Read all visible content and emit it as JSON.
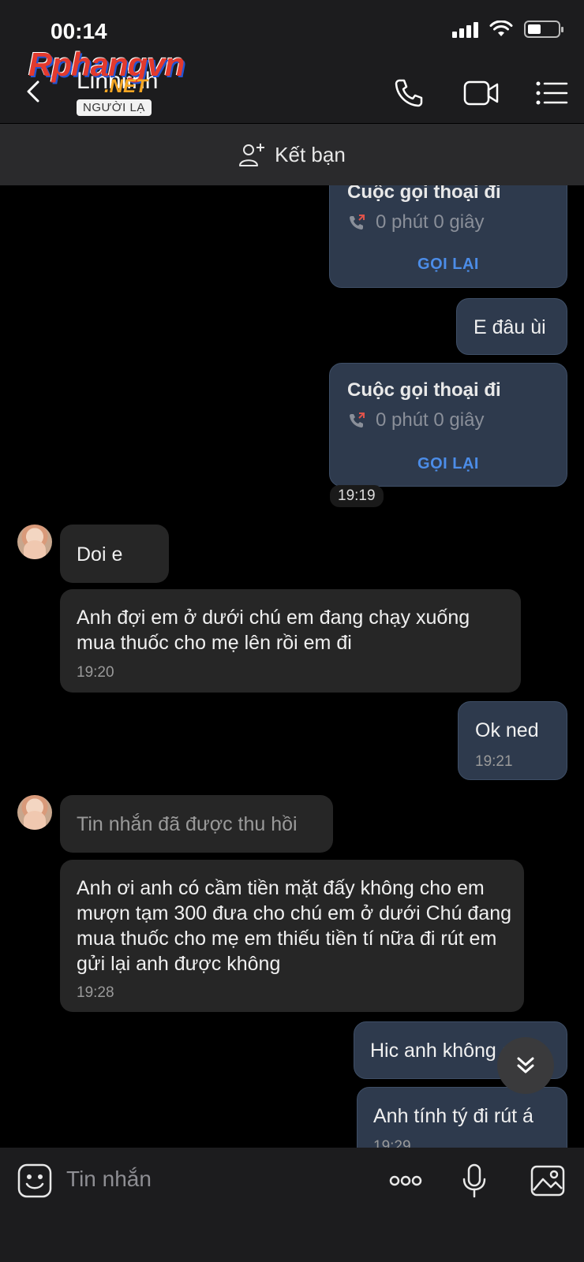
{
  "status_bar": {
    "time": "00:14",
    "battery_level": 0.45
  },
  "watermark": {
    "brand": "Rphangvn",
    "suffix": ".NET"
  },
  "header": {
    "contact_name": "Linhlinh",
    "badge": "NGƯỜI LẠ",
    "icons": [
      "back-icon",
      "phone-icon",
      "video-icon",
      "menu-icon"
    ]
  },
  "friend_bar": {
    "label": "Kết bạn",
    "icon": "add-friend-icon"
  },
  "messages": {
    "call1": {
      "title": "Cuộc gọi thoại đi",
      "duration": "0 phút 0 giây",
      "action": "GỌI LẠI"
    },
    "out1": {
      "text": "E đâu ùi"
    },
    "call2": {
      "title": "Cuộc gọi thoại đi",
      "duration": "0 phút 0 giây",
      "action": "GỌI LẠI"
    },
    "time_chip": "19:19",
    "in1": {
      "text": "Doi e"
    },
    "in2": {
      "text": "Anh đợi em ở dưới chú em đang chạy xuống mua thuốc cho mẹ lên rồi em đi",
      "time": "19:20"
    },
    "out2": {
      "text": "Ok ned",
      "time": "19:21"
    },
    "in3": {
      "text": "Tin nhắn đã được thu hồi"
    },
    "in4": {
      "text": "Anh ơi anh có cầm tiền mặt đấy không cho em mượn tạm 300 đưa cho chú em ở dưới Chú đang mua thuốc cho mẹ em thiếu tiền tí nữa đi rút em gửi lại anh được không",
      "time": "19:28"
    },
    "out3": {
      "text": "Hic anh không cod"
    },
    "out4": {
      "text": "Anh tính tý đi rút á",
      "time": "19:29"
    }
  },
  "input_bar": {
    "placeholder": "Tin nhắn",
    "icons": [
      "emoji-icon",
      "more-icon",
      "microphone-icon",
      "image-icon"
    ]
  },
  "colors": {
    "background": "#000000",
    "outgoing_bubble": "#2e3a4d",
    "incoming_bubble": "#262626",
    "accent": "#4c8de8",
    "missed_call": "#e0534a"
  }
}
